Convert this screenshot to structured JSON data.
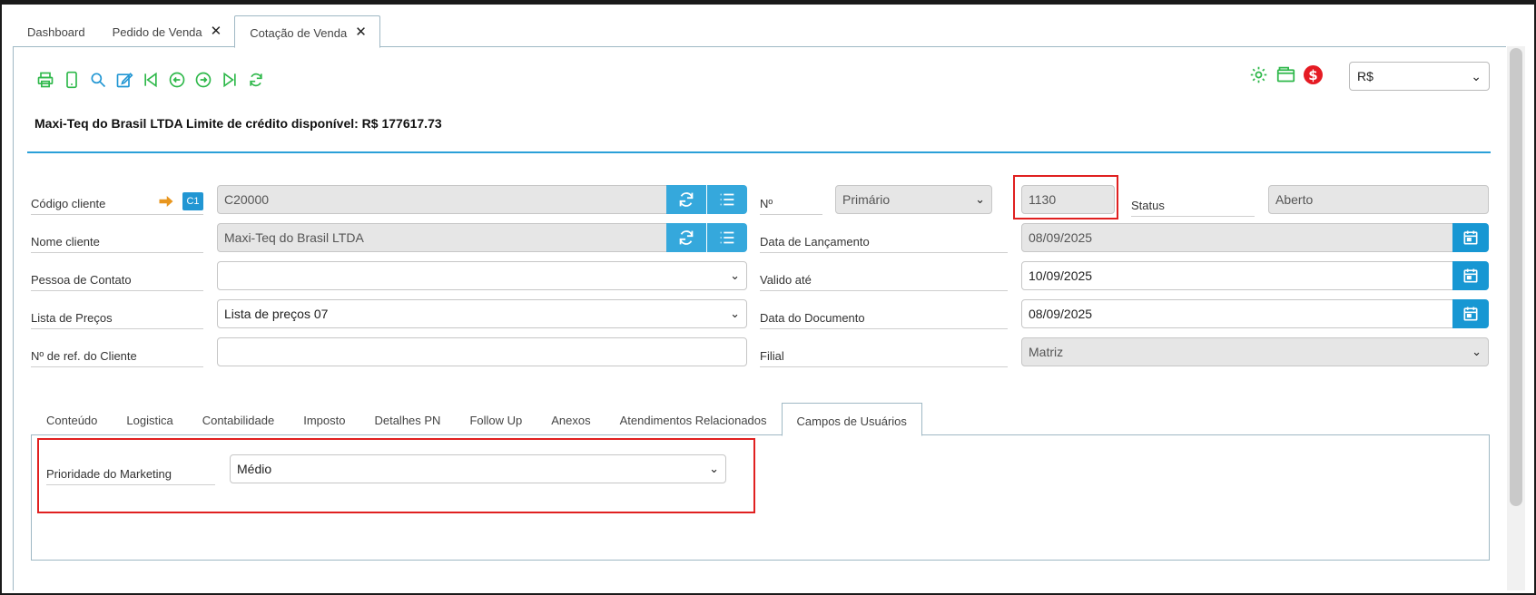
{
  "tabs": [
    {
      "label": "Dashboard",
      "closable": false
    },
    {
      "label": "Pedido de Venda",
      "closable": true
    },
    {
      "label": "Cotação de Venda",
      "closable": true,
      "active": true
    }
  ],
  "toolbar": {
    "icons": [
      "print-icon",
      "mobile-icon",
      "search-icon",
      "edit-icon",
      "first-record-icon",
      "previous-record-icon",
      "next-record-icon",
      "last-record-icon",
      "refresh-icon"
    ]
  },
  "right_icons": [
    "gear-icon",
    "wallet-icon",
    "money-icon"
  ],
  "currency": {
    "selected": "R$"
  },
  "header": {
    "title": "Maxi-Teq do Brasil LTDA Limite de crédito disponível: R$ 177617.73"
  },
  "form": {
    "codigo_cliente": {
      "label": "Código cliente",
      "value": "C20000",
      "badge": "C1"
    },
    "nome_cliente": {
      "label": "Nome cliente",
      "value": "Maxi-Teq do Brasil LTDA"
    },
    "pessoa_contato": {
      "label": "Pessoa de Contato",
      "value": ""
    },
    "lista_precos": {
      "label": "Lista de Preços",
      "value": "Lista de preços 07"
    },
    "ref_cliente": {
      "label": "Nº de ref. do Cliente",
      "value": ""
    },
    "numero": {
      "label": "Nº",
      "series": "Primário",
      "value": "1130"
    },
    "status": {
      "label": "Status",
      "value": "Aberto"
    },
    "data_lancamento": {
      "label": "Data de Lançamento",
      "value": "08/09/2025"
    },
    "valido_ate": {
      "label": "Valido até",
      "value": "10/09/2025"
    },
    "data_documento": {
      "label": "Data do Documento",
      "value": "08/09/2025"
    },
    "filial": {
      "label": "Filial",
      "value": "Matriz"
    }
  },
  "sub_tabs": [
    "Conteúdo",
    "Logistica",
    "Contabilidade",
    "Imposto",
    "Detalhes PN",
    "Follow Up",
    "Anexos",
    "Atendimentos Relacionados",
    "Campos de Usuários"
  ],
  "user_fields": {
    "prioridade_marketing": {
      "label": "Prioridade do Marketing",
      "value": "Médio"
    }
  },
  "colors": {
    "accent": "#35a8dc",
    "green_icons": "#2eb84a",
    "highlight": "#e02020"
  }
}
